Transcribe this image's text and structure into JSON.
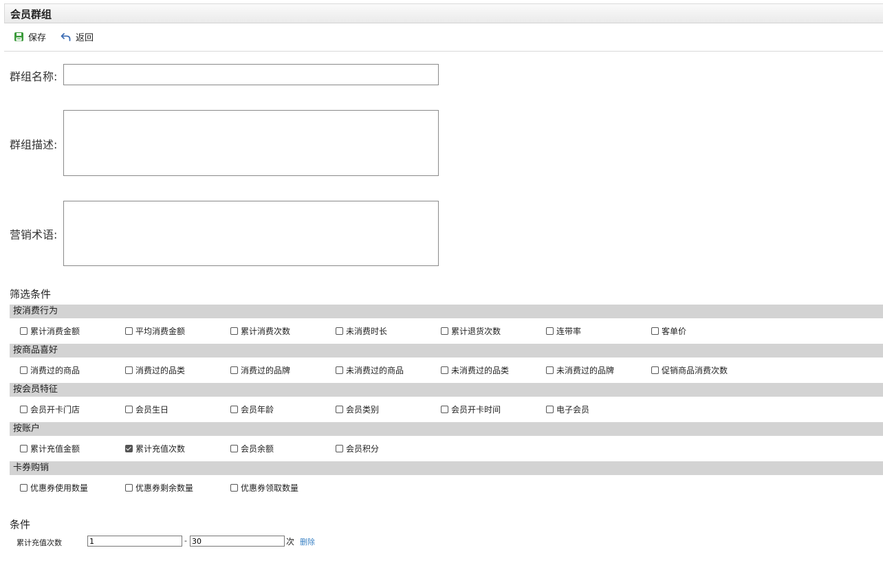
{
  "window": {
    "title": "会员群组"
  },
  "toolbar": {
    "save_label": "保存",
    "back_label": "返回"
  },
  "form": {
    "group_name_label": "群组名称:",
    "group_name_value": "",
    "group_desc_label": "群组描述:",
    "group_desc_value": "",
    "marketing_label": "营销术语:",
    "marketing_value": ""
  },
  "filters": {
    "title": "筛选条件",
    "groups": [
      {
        "header": "按消费行为",
        "options": [
          {
            "label": "累计消费金额",
            "checked": false
          },
          {
            "label": "平均消费金额",
            "checked": false
          },
          {
            "label": "累计消费次数",
            "checked": false
          },
          {
            "label": "未消费时长",
            "checked": false
          },
          {
            "label": "累计退货次数",
            "checked": false
          },
          {
            "label": "连带率",
            "checked": false
          },
          {
            "label": "客单价",
            "checked": false
          }
        ]
      },
      {
        "header": "按商品喜好",
        "options": [
          {
            "label": "消费过的商品",
            "checked": false
          },
          {
            "label": "消费过的品类",
            "checked": false
          },
          {
            "label": "消费过的品牌",
            "checked": false
          },
          {
            "label": "未消费过的商品",
            "checked": false
          },
          {
            "label": "未消费过的品类",
            "checked": false
          },
          {
            "label": "未消费过的品牌",
            "checked": false
          },
          {
            "label": "促销商品消费次数",
            "checked": false
          }
        ]
      },
      {
        "header": "按会员特征",
        "options": [
          {
            "label": "会员开卡门店",
            "checked": false
          },
          {
            "label": "会员生日",
            "checked": false
          },
          {
            "label": "会员年龄",
            "checked": false
          },
          {
            "label": "会员类别",
            "checked": false
          },
          {
            "label": "会员开卡时间",
            "checked": false
          },
          {
            "label": "电子会员",
            "checked": false
          }
        ]
      },
      {
        "header": "按账户",
        "options": [
          {
            "label": "累计充值金额",
            "checked": false
          },
          {
            "label": "累计充值次数",
            "checked": true
          },
          {
            "label": "会员余额",
            "checked": false
          },
          {
            "label": "会员积分",
            "checked": false
          }
        ]
      },
      {
        "header": "卡券购销",
        "options": [
          {
            "label": "优惠券使用数量",
            "checked": false
          },
          {
            "label": "优惠券剩余数量",
            "checked": false
          },
          {
            "label": "优惠券领取数量",
            "checked": false
          }
        ]
      }
    ]
  },
  "conditions": {
    "title": "条件",
    "rows": [
      {
        "label": "累计充值次数",
        "min": "1",
        "max": "30",
        "separator": "-",
        "unit": "次",
        "delete_label": "删除"
      }
    ]
  },
  "colors": {
    "header_bg": "#d3d3d3",
    "link": "#3b82c4",
    "save_icon": "#3a9a3a",
    "back_icon": "#3f6fb5"
  },
  "icons": {
    "save": "save-icon",
    "back": "back-arrow-icon"
  }
}
